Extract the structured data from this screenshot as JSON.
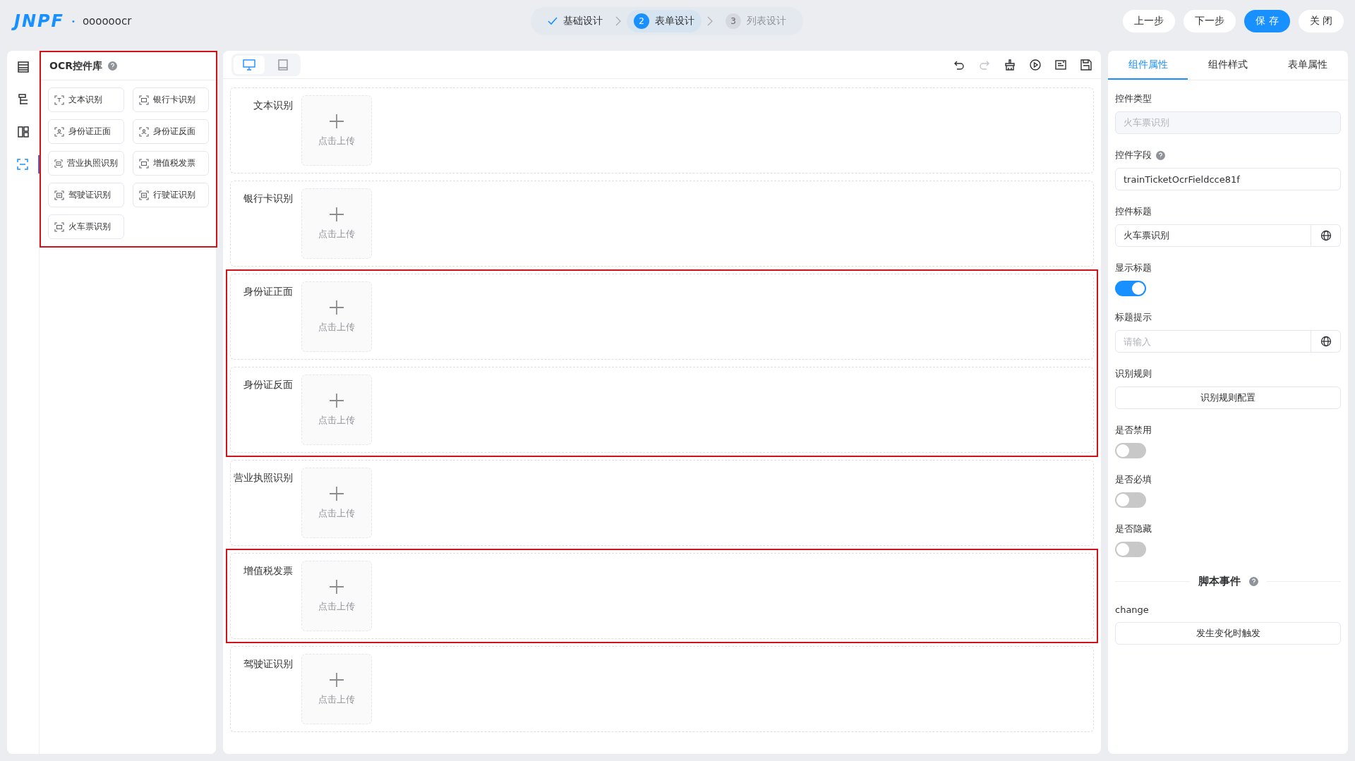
{
  "header": {
    "logo": "JNPF",
    "dot": "•",
    "app_name": "oooooocr"
  },
  "steps": [
    {
      "label": "基础设计",
      "done": true,
      "selected": false
    },
    {
      "number": "2",
      "label": "表单设计",
      "done": false,
      "selected": true
    },
    {
      "number": "3",
      "label": "列表设计",
      "done": false,
      "selected": false
    }
  ],
  "header_buttons": [
    {
      "label": "上一步",
      "primary": false
    },
    {
      "label": "下一步",
      "primary": false
    },
    {
      "label": "保 存",
      "primary": true
    },
    {
      "label": "关 闭",
      "primary": false
    }
  ],
  "rail": [
    {
      "selected": false
    },
    {
      "selected": false
    },
    {
      "selected": false
    },
    {
      "selected": true
    }
  ],
  "library": {
    "title": "OCR控件库",
    "highlighted": true,
    "items": [
      {
        "label": "文本识别"
      },
      {
        "label": "银行卡识别"
      },
      {
        "label": "身份证正面"
      },
      {
        "label": "身份证反面"
      },
      {
        "label": "营业执照识别"
      },
      {
        "label": "增值税发票"
      },
      {
        "label": "驾驶证识别"
      },
      {
        "label": "行驶证识别"
      },
      {
        "label": "火车票识别"
      }
    ]
  },
  "canvas": {
    "devices": [
      {
        "kind": "desktop",
        "selected": true
      },
      {
        "kind": "tablet",
        "selected": false
      }
    ],
    "tools": [
      {
        "kind": "undo",
        "disabled": false
      },
      {
        "kind": "redo",
        "disabled": true
      },
      {
        "kind": "clear",
        "disabled": false
      },
      {
        "kind": "preview",
        "disabled": false
      },
      {
        "kind": "code",
        "disabled": false
      },
      {
        "kind": "export",
        "disabled": false
      }
    ],
    "groups": [
      {
        "highlighted": false,
        "rows": [
          {
            "label": "文本识别",
            "upload": "点击上传"
          }
        ]
      },
      {
        "highlighted": false,
        "rows": [
          {
            "label": "银行卡识别",
            "upload": "点击上传"
          }
        ]
      },
      {
        "highlighted": true,
        "rows": [
          {
            "label": "身份证正面",
            "upload": "点击上传"
          },
          {
            "label": "身份证反面",
            "upload": "点击上传"
          }
        ]
      },
      {
        "highlighted": false,
        "rows": [
          {
            "label": "营业执照识别",
            "upload": "点击上传"
          }
        ]
      },
      {
        "highlighted": true,
        "rows": [
          {
            "label": "增值税发票",
            "upload": "点击上传"
          }
        ]
      },
      {
        "highlighted": false,
        "rows": [
          {
            "label": "驾驶证识别",
            "upload": "点击上传"
          }
        ]
      }
    ]
  },
  "properties": {
    "tabs": [
      {
        "label": "组件属性",
        "selected": true
      },
      {
        "label": "组件样式",
        "selected": false
      },
      {
        "label": "表单属性",
        "selected": false
      }
    ],
    "fields": [
      {
        "kind": "readonly",
        "label": "控件类型",
        "value": "火车票识别"
      },
      {
        "kind": "input",
        "label": "控件字段",
        "help": true,
        "value": "trainTicketOcrFieldcce81f"
      },
      {
        "kind": "i18n",
        "label": "控件标题",
        "value": "火车票识别"
      },
      {
        "kind": "switch",
        "label": "显示标题",
        "on": true
      },
      {
        "kind": "i18n",
        "label": "标题提示",
        "placeholder": "请输入"
      },
      {
        "kind": "button",
        "label": "识别规则",
        "button": "识别规则配置"
      },
      {
        "kind": "switch",
        "label": "是否禁用",
        "on": false
      },
      {
        "kind": "switch",
        "label": "是否必填",
        "on": false
      },
      {
        "kind": "switch",
        "label": "是否隐藏",
        "on": false
      },
      {
        "kind": "divider",
        "label": "脚本事件",
        "help": true
      },
      {
        "kind": "button",
        "label": "change",
        "button": "发生变化时触发"
      }
    ]
  }
}
